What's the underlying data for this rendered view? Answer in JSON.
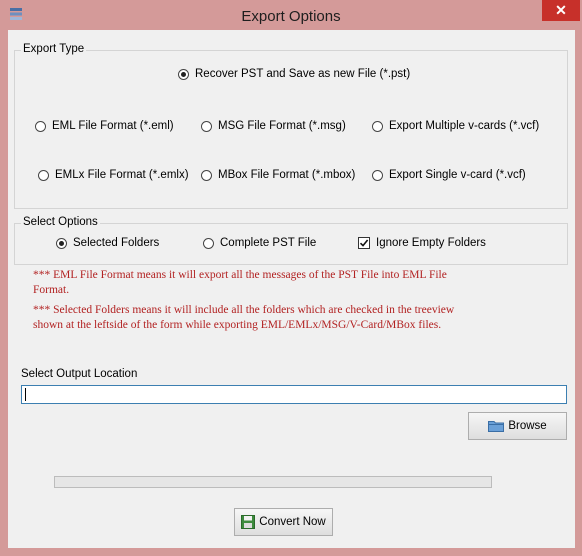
{
  "window": {
    "title": "Export Options",
    "close_glyph": "✕",
    "app_icon": "mail-stack-icon",
    "close_icon": "close-icon"
  },
  "export_type": {
    "legend": "Export Type",
    "options": [
      {
        "label": "Recover PST and Save as new File (*.pst)",
        "selected": true
      },
      {
        "label": "EML File  Format (*.eml)",
        "selected": false
      },
      {
        "label": "MSG File Format (*.msg)",
        "selected": false
      },
      {
        "label": "Export Multiple v-cards (*.vcf)",
        "selected": false
      },
      {
        "label": "EMLx File  Format (*.emlx)",
        "selected": false
      },
      {
        "label": "MBox File Format (*.mbox)",
        "selected": false
      },
      {
        "label": "Export Single v-card (*.vcf)",
        "selected": false
      }
    ]
  },
  "select_options": {
    "legend": "Select Options",
    "selected_folders": {
      "label": "Selected Folders",
      "selected": true
    },
    "complete_pst": {
      "label": "Complete PST File",
      "selected": false
    },
    "ignore_empty": {
      "label": "Ignore Empty Folders",
      "checked": true
    }
  },
  "notes": {
    "eml_note_line1": "*** EML File Format means it will export all the messages of the PST File into EML File",
    "eml_note_line2": "Format.",
    "folders_note_line1": "*** Selected Folders means it will include all the folders which are checked in the treeview",
    "folders_note_line2": "shown at the leftside of the form while exporting EML/EMLx/MSG/V-Card/MBox files."
  },
  "output": {
    "label": "Select Output Location",
    "value": "",
    "browse_label": "Browse",
    "browse_icon": "folder-icon"
  },
  "progress": {
    "value": 0
  },
  "convert": {
    "label": "Convert Now",
    "icon": "save-icon"
  },
  "colors": {
    "window_frame": "#d49a99",
    "close_button": "#c7302a",
    "note_text": "#b22222",
    "input_border": "#3c7fb1"
  }
}
